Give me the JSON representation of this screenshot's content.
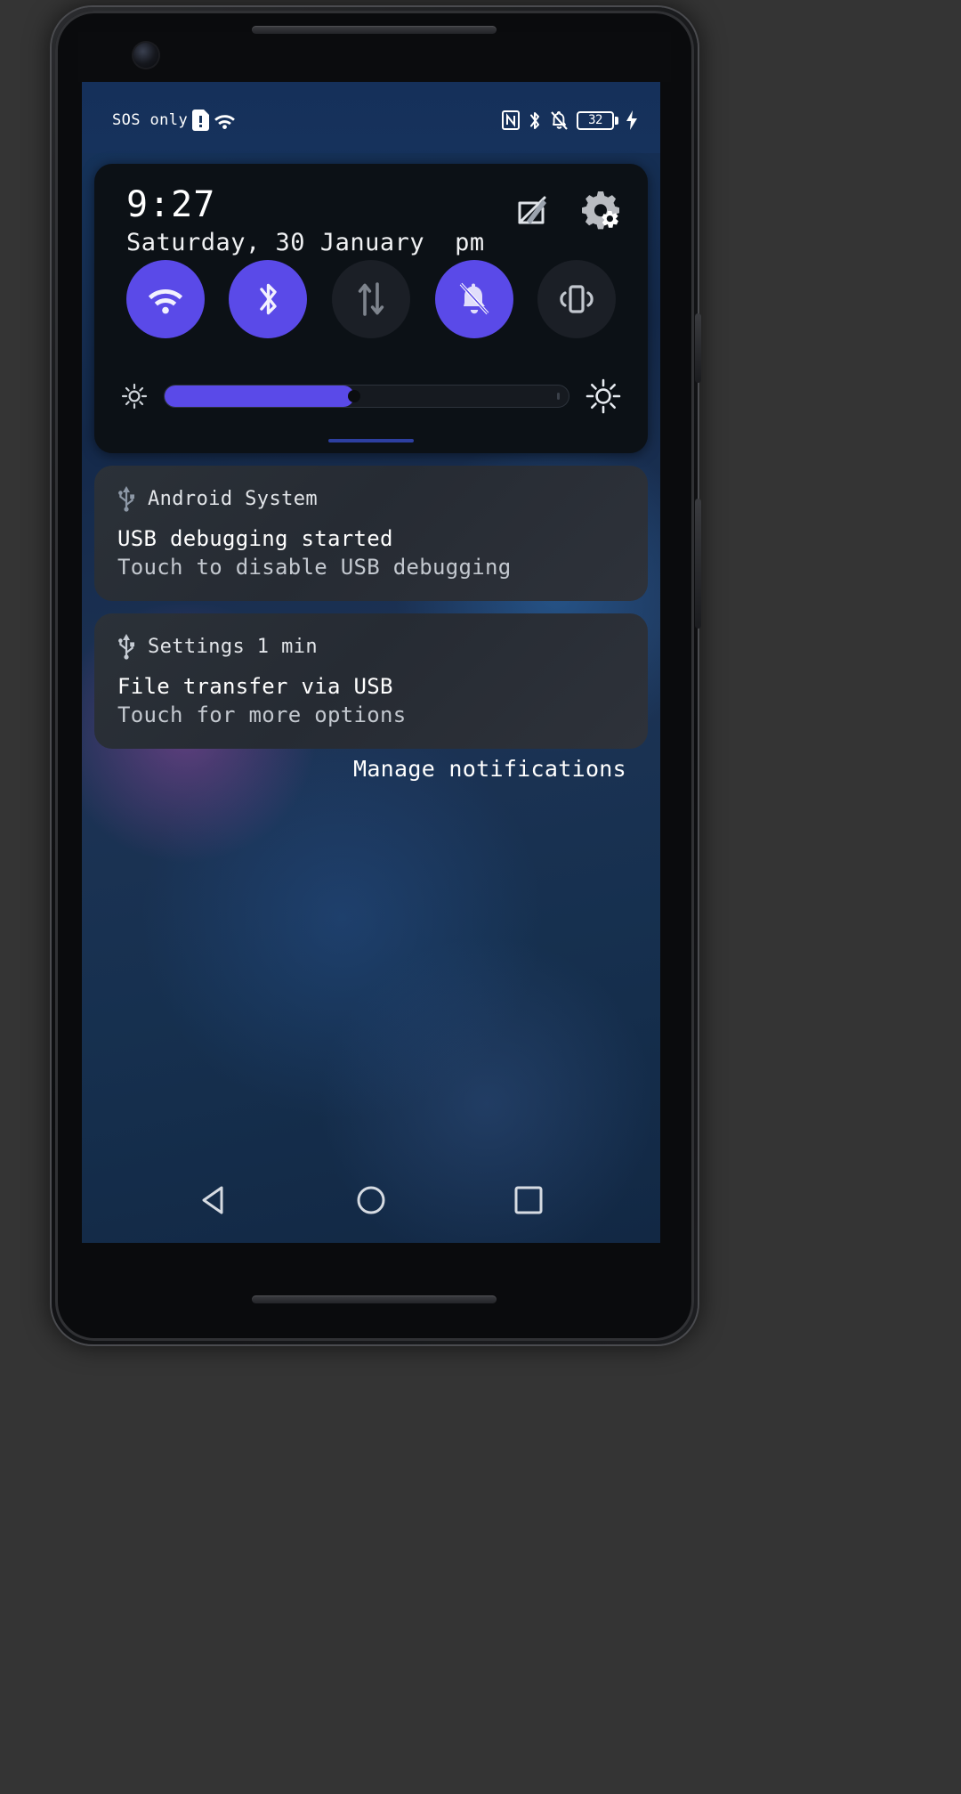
{
  "status_bar": {
    "carrier_text": "SOS only",
    "left_icons": [
      "sim-card-alert-icon",
      "wifi-icon"
    ],
    "right_icons": [
      "nfc-icon",
      "bluetooth-icon",
      "notifications-off-icon"
    ],
    "battery_level": "32",
    "battery_charging": true
  },
  "quick_settings": {
    "time": "9:27",
    "date": "Saturday, 30 January",
    "am_pm": "pm",
    "edit_icon": "edit-icon",
    "settings_icon": "gear-icon",
    "accent_color": "#5a4ae8",
    "tiles": [
      {
        "name": "wifi",
        "icon": "wifi-icon",
        "state": "on"
      },
      {
        "name": "bluetooth",
        "icon": "bluetooth-icon",
        "state": "on"
      },
      {
        "name": "mobile-data",
        "icon": "mobile-data-icon",
        "state": "off"
      },
      {
        "name": "silent",
        "icon": "notifications-off-icon",
        "state": "on"
      },
      {
        "name": "vibrate",
        "icon": "vibrate-icon",
        "state": "off"
      }
    ],
    "brightness": {
      "low_icon": "brightness-low-icon",
      "high_icon": "brightness-high-icon",
      "value_percent": 47
    }
  },
  "notifications": [
    {
      "app_icon": "usb-icon",
      "app_name": "Android System",
      "title": "USB debugging started",
      "subtitle": "Touch to disable USB debugging"
    },
    {
      "app_icon": "usb-icon",
      "app_name": "Settings 1 min",
      "title": "File transfer via USB",
      "subtitle": "Touch for more options"
    }
  ],
  "manage_notifications_label": "Manage notifications",
  "nav_bar": {
    "back": "back-icon",
    "home": "home-icon",
    "recents": "recents-icon"
  }
}
